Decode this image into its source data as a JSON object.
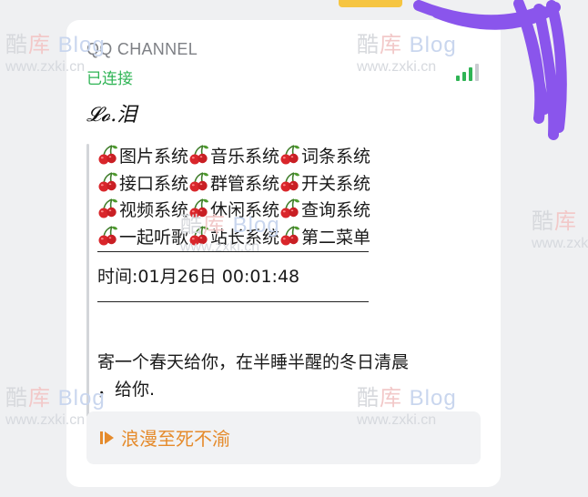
{
  "header": {
    "channel_name": "QQ CHANNEL",
    "connection_status": "已连接",
    "signal_icon": "signal-bars-icon"
  },
  "message": {
    "sender": "𝓛𝓸.泪",
    "menu_icon": "cherry-icon",
    "menu_rows": [
      [
        "图片系统",
        "音乐系统",
        "词条系统"
      ],
      [
        "接口系统",
        "群管系统",
        "开关系统"
      ],
      [
        "视频系统",
        "休闲系统",
        "查询系统"
      ],
      [
        "一起听歌",
        "站长系统",
        "第二菜单"
      ]
    ],
    "time_text": "时间:01月26日 00:01:48",
    "quote": [
      "寄一个春天给你，在半睡半醒的冬日清晨",
      "，给你."
    ]
  },
  "music": {
    "icon": "play-icon",
    "title": "浪漫至死不渝"
  },
  "watermark": {
    "brand_a": "酷",
    "brand_b": "库",
    "brand_c": "Blog",
    "url": "www.zxki.cn"
  },
  "colors": {
    "status_green": "#2fb455",
    "music_orange": "#e58b2c",
    "card_bg": "#ffffff",
    "page_bg": "#eff0f2"
  }
}
